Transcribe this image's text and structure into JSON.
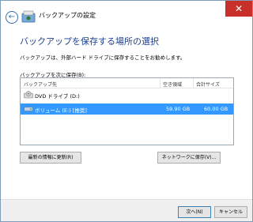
{
  "window": {
    "title": "バックアップの設定",
    "close_glyph": "✕",
    "back_glyph": "←"
  },
  "page": {
    "heading": "バックアップを保存する場所の選択",
    "description": "バックアップは、外部ハード ドライブに保存することをお勧めします。",
    "list_label": "バックアップを次に保存(B):"
  },
  "list": {
    "columns": [
      "バックアップ先",
      "空き領域",
      "合計サイズ"
    ],
    "rows": [
      {
        "name": "DVD ドライブ (D:)",
        "free": "",
        "total": "",
        "icon": "dvd-drive-icon"
      },
      {
        "name": "ボリューム (E:) [推奨]",
        "free": "59.90 GB",
        "total": "60.00 GB",
        "icon": "hard-drive-icon"
      }
    ]
  },
  "buttons": {
    "refresh": "最新の情報に更新(R)",
    "network": "ネットワークに保存(V)...",
    "next": "次へ(N)",
    "cancel": "キャンセル"
  },
  "colors": {
    "heading": "#1c3f8f",
    "selection": "#3399ff",
    "close": "#c7302b"
  }
}
